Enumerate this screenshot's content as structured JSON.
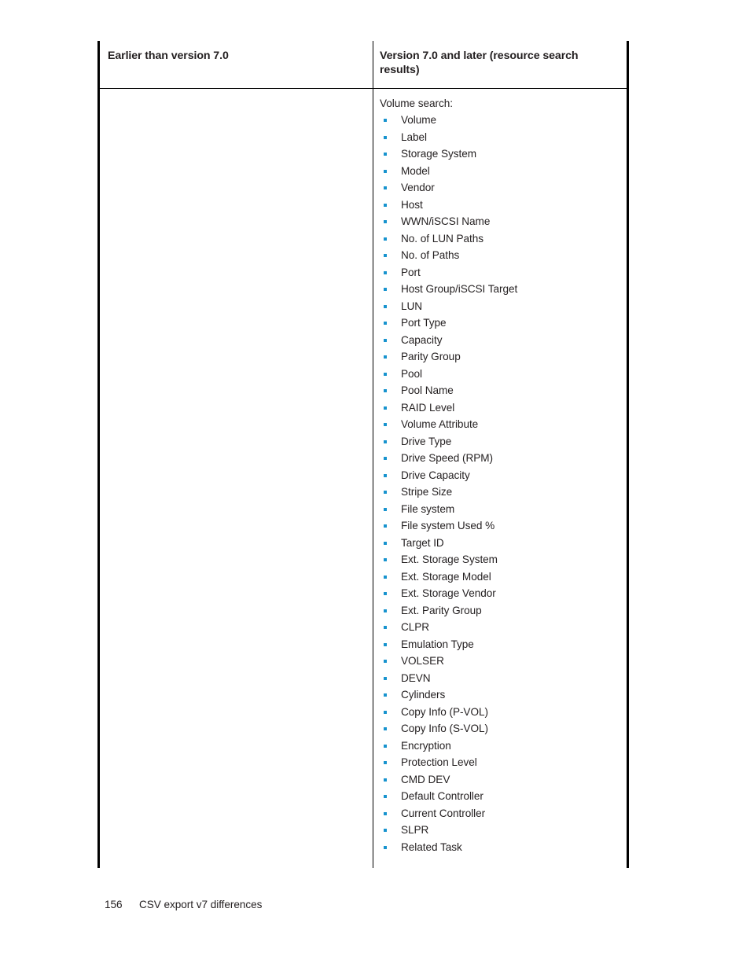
{
  "document": {
    "table": {
      "headers": [
        "Earlier than version 7.0",
        "Version 7.0 and later (resource search results)"
      ],
      "left_column_content": "",
      "right_column": {
        "intro": "Volume search:",
        "items": [
          "Volume",
          "Label",
          "Storage System",
          "Model",
          "Vendor",
          "Host",
          "WWN/iSCSI Name",
          "No. of LUN Paths",
          "No. of Paths",
          "Port",
          "Host Group/iSCSI Target",
          "LUN",
          "Port Type",
          "Capacity",
          "Parity Group",
          "Pool",
          "Pool Name",
          "RAID Level",
          "Volume Attribute",
          "Drive Type",
          "Drive Speed (RPM)",
          "Drive Capacity",
          "Stripe Size",
          "File system",
          "File system Used %",
          "Target ID",
          "Ext. Storage System",
          "Ext. Storage Model",
          "Ext. Storage Vendor",
          "Ext. Parity Group",
          "CLPR",
          "Emulation Type",
          "VOLSER",
          "DEVN",
          "Cylinders",
          "Copy Info (P-VOL)",
          "Copy Info (S-VOL)",
          "Encryption",
          "Protection Level",
          "CMD DEV",
          "Default Controller",
          "Current Controller",
          "SLPR",
          "Related Task"
        ]
      }
    },
    "footer": {
      "page_number": "156",
      "title": "CSV export v7 differences"
    },
    "colors": {
      "bullet": "#1793ce",
      "rule": "#000000",
      "text": "#231f20"
    }
  }
}
